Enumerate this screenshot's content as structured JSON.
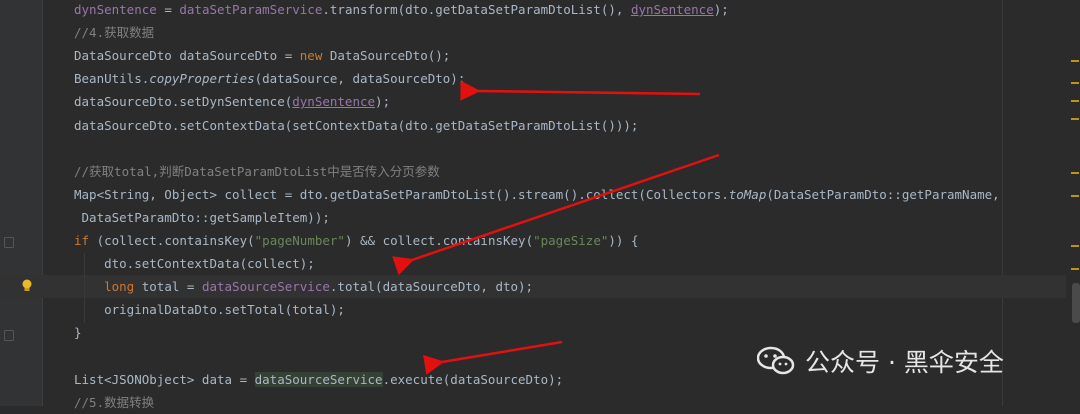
{
  "code_lines": [
    {
      "id": "l1",
      "segments": [
        [
          "dynSentence",
          "fld"
        ],
        [
          " = ",
          ""
        ],
        [
          "dataSetParamService",
          "fld"
        ],
        [
          ".transform(dto.getDataSetParamDtoList(), ",
          ""
        ],
        [
          "dynSentence",
          "fld"
        ],
        [
          ");",
          ""
        ]
      ]
    },
    {
      "id": "l2",
      "segments": [
        [
          "//4.获取数据",
          "cmt"
        ]
      ]
    },
    {
      "id": "l3",
      "segments": [
        [
          "DataSourceDto dataSourceDto = ",
          ""
        ],
        [
          "new",
          "kw"
        ],
        [
          " DataSourceDto();",
          ""
        ]
      ]
    },
    {
      "id": "l4",
      "segments": [
        [
          "BeanUtils.",
          ""
        ],
        [
          "copyProperties",
          "ital"
        ],
        [
          "(dataSource, dataSourceDto);",
          ""
        ]
      ]
    },
    {
      "id": "l5",
      "segments": [
        [
          "dataSourceDto.setDynSentence(",
          ""
        ],
        [
          "dynSentence",
          "fld"
        ],
        [
          ");",
          ""
        ]
      ]
    },
    {
      "id": "l6",
      "segments": [
        [
          "dataSourceDto.setContextData(setContextData(dto.getDataSetParamDtoList()));",
          ""
        ]
      ]
    },
    {
      "id": "l7",
      "segments": []
    },
    {
      "id": "l8",
      "segments": [
        [
          "//获取total,判断DataSetParamDtoList中是否传入分页参数",
          "cmt"
        ]
      ]
    },
    {
      "id": "l9",
      "segments": [
        [
          "Map<String, Object> collect = dto.getDataSetParamDtoList().stream().collect(Collectors.",
          ""
        ],
        [
          "toMap",
          "ital"
        ],
        [
          "(DataSetParamDto::getParamName,",
          ""
        ]
      ]
    },
    {
      "id": "l10",
      "segments": [
        [
          " DataSetParamDto::getSampleItem));",
          ""
        ]
      ]
    },
    {
      "id": "l11",
      "segments": [
        [
          "if",
          "kw"
        ],
        [
          " (collect.containsKey(",
          ""
        ],
        [
          "\"pageNumber\"",
          "str"
        ],
        [
          ") && collect.containsKey(",
          ""
        ],
        [
          "\"pageSize\"",
          "str"
        ],
        [
          ")) {",
          ""
        ]
      ]
    },
    {
      "id": "l12",
      "segments": [
        [
          "    dto.setContextData(collect);",
          ""
        ]
      ]
    },
    {
      "id": "l13",
      "segments": [
        [
          "    ",
          ""
        ],
        [
          "long",
          "kw"
        ],
        [
          " total = ",
          ""
        ],
        [
          "dataSourceService",
          "fld"
        ],
        [
          ".total(dataSourceDto, dto);",
          ""
        ]
      ]
    },
    {
      "id": "l14",
      "segments": [
        [
          "    originalDataDto.setTotal(total);",
          ""
        ]
      ]
    },
    {
      "id": "l15",
      "segments": [
        [
          "}",
          ""
        ]
      ]
    },
    {
      "id": "l16",
      "segments": []
    },
    {
      "id": "l17",
      "segments": [
        [
          "List<JSONObject> data = ",
          ""
        ],
        [
          "dataSourceService",
          "svc"
        ],
        [
          ".execute(dataSourceDto);",
          ""
        ]
      ]
    },
    {
      "id": "l18",
      "segments": [
        [
          "//5.数据转换",
          "cmt"
        ]
      ]
    }
  ],
  "watermark": {
    "text": "公众号 · 黑伞安全"
  },
  "colors": {
    "arrow": "#e31010",
    "background": "#2b2b2b"
  },
  "icons": {
    "bulb": "lightbulb-icon",
    "fold": "fold-marker-icon",
    "wechat": "wechat-icon"
  }
}
